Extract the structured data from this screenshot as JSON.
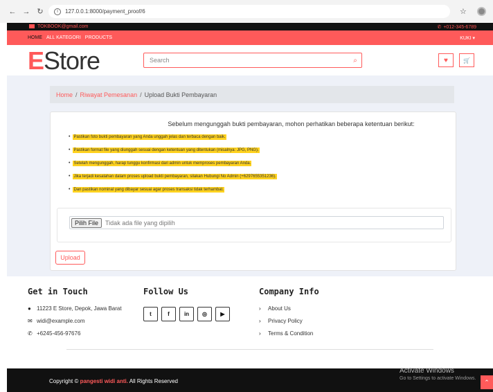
{
  "browser": {
    "url": "127.0.0.1:8000/payment_proof/6",
    "back_icon": "←",
    "forward_icon": "→",
    "reload_icon": "↻",
    "info_icon": "i",
    "star_icon": "☆"
  },
  "topbar": {
    "email": "TOKBOOK@gmail.com",
    "phone": "+012-345-6789",
    "phone_icon": "✆"
  },
  "menu": {
    "items": [
      "HOME",
      "ALL KATEGORI",
      "PRODUCTS"
    ],
    "user": "KUKI"
  },
  "header": {
    "logo_first": "E",
    "logo_rest": "Store",
    "search_placeholder": "Search",
    "search_icon": "⌕",
    "wishlist_icon": "♥",
    "cart_icon": "🛒"
  },
  "breadcrumb": {
    "home": "Home",
    "orders": "Riwayat Pemesanan",
    "current": "Upload Bukti Pembayaran",
    "separator": "/"
  },
  "upload": {
    "intro": "Sebelum mengunggah bukti pembayaran, mohon perhatikan beberapa ketentuan berikut:",
    "rules": [
      "Pastikan foto bukti pembayaran yang Anda unggah jelas dan terbaca dengan baik.",
      "Pastikan format file yang diunggah sesuai dengan ketentuan yang ditentukan (misalnya: JPG, PNG).",
      "Setelah mengunggah, harap tunggu konfirmasi dari admin untuk memproses pembayaran Anda.",
      "Jika terjadi kesalahan dalam proses upload bukti pembayaran, silakan Hubungi No Admin (+6297655351236).",
      "Dan pastikan nominal yang dibayar sesuai agar proses transaksi tidak terhambat."
    ],
    "file_button": "Pilih File",
    "file_status": "Tidak ada file yang dipilih",
    "submit": "Upload"
  },
  "footer": {
    "contact_title": "Get in Touch",
    "address": "11223 E Store, Depok, Jawa Barat",
    "email": "widi@example.com",
    "phone": "+6245-456-97676",
    "follow_title": "Follow Us",
    "social": [
      "t",
      "f",
      "in",
      "◎",
      "▶"
    ],
    "company_title": "Company Info",
    "links": [
      "About Us",
      "Privacy Policy",
      "Terms & Condition"
    ],
    "copyright_pre": "Copyright ©",
    "copyright_brand": "pangesti widi anti.",
    "copyright_post": "All Rights Reserved"
  },
  "watermark": {
    "line1": "Activate Windows",
    "line2": "Go to Settings to activate Windows."
  },
  "colors": {
    "accent": "#ff5a5a",
    "highlight": "#ffd21f",
    "dark": "#111111"
  }
}
